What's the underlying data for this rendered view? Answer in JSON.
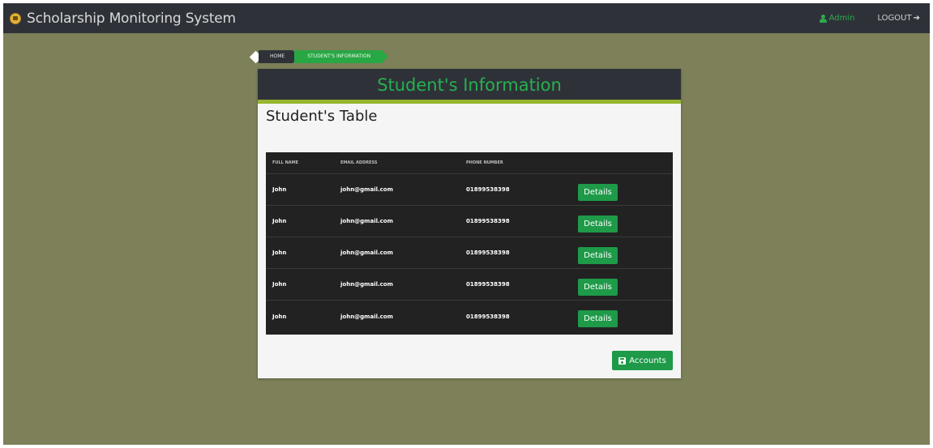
{
  "navbar": {
    "title": "Scholarship Monitoring System",
    "brand_icon": "shield-icon",
    "user_label": "Admin",
    "user_icon": "user-icon",
    "logout_label": "LOGOUT",
    "logout_icon": "sign-out-icon"
  },
  "breadcrumb": {
    "home": "HOME",
    "current": "STUDENT'S INFORMATION"
  },
  "card": {
    "header_title": "Student's Information",
    "table_title": "Student's Table"
  },
  "table": {
    "headers": [
      "FULL NAME",
      "EMAIL ADDRESS",
      "PHONE NUMBER",
      ""
    ],
    "rows": [
      {
        "name": "John",
        "email": "john@gmail.com",
        "phone": "01899538398",
        "action": "Details"
      },
      {
        "name": "John",
        "email": "john@gmail.com",
        "phone": "01899538398",
        "action": "Details"
      },
      {
        "name": "John",
        "email": "john@gmail.com",
        "phone": "01899538398",
        "action": "Details"
      },
      {
        "name": "John",
        "email": "john@gmail.com",
        "phone": "01899538398",
        "action": "Details"
      },
      {
        "name": "John",
        "email": "john@gmail.com",
        "phone": "01899538398",
        "action": "Details"
      }
    ]
  },
  "actions": {
    "accounts_label": "Accounts",
    "accounts_icon": "save-icon"
  },
  "colors": {
    "background": "#7d8058",
    "navbar": "#2e3238",
    "accent_green": "#28a745",
    "accent_olive": "#96b52f"
  }
}
